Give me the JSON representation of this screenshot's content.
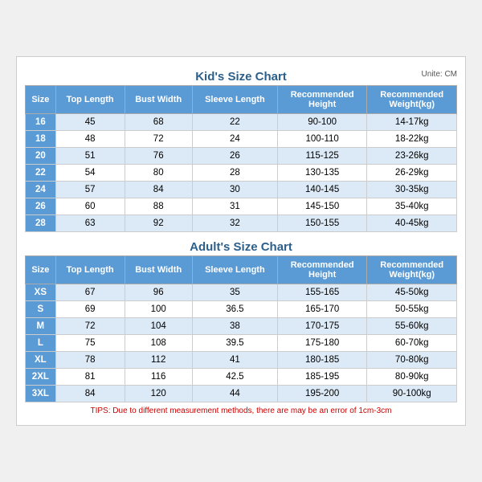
{
  "kids": {
    "title": "Kid's Size Chart",
    "unit": "Unite: CM",
    "headers": [
      "Size",
      "Top Length",
      "Bust Width",
      "Sleeve Length",
      "Recommended Height",
      "Recommended Weight(kg)"
    ],
    "rows": [
      [
        "16",
        "45",
        "68",
        "22",
        "90-100",
        "14-17kg"
      ],
      [
        "18",
        "48",
        "72",
        "24",
        "100-110",
        "18-22kg"
      ],
      [
        "20",
        "51",
        "76",
        "26",
        "115-125",
        "23-26kg"
      ],
      [
        "22",
        "54",
        "80",
        "28",
        "130-135",
        "26-29kg"
      ],
      [
        "24",
        "57",
        "84",
        "30",
        "140-145",
        "30-35kg"
      ],
      [
        "26",
        "60",
        "88",
        "31",
        "145-150",
        "35-40kg"
      ],
      [
        "28",
        "63",
        "92",
        "32",
        "150-155",
        "40-45kg"
      ]
    ]
  },
  "adults": {
    "title": "Adult's Size Chart",
    "headers": [
      "Size",
      "Top Length",
      "Bust Width",
      "Sleeve Length",
      "Recommended Height",
      "Recommended Weight(kg)"
    ],
    "rows": [
      [
        "XS",
        "67",
        "96",
        "35",
        "155-165",
        "45-50kg"
      ],
      [
        "S",
        "69",
        "100",
        "36.5",
        "165-170",
        "50-55kg"
      ],
      [
        "M",
        "72",
        "104",
        "38",
        "170-175",
        "55-60kg"
      ],
      [
        "L",
        "75",
        "108",
        "39.5",
        "175-180",
        "60-70kg"
      ],
      [
        "XL",
        "78",
        "112",
        "41",
        "180-185",
        "70-80kg"
      ],
      [
        "2XL",
        "81",
        "116",
        "42.5",
        "185-195",
        "80-90kg"
      ],
      [
        "3XL",
        "84",
        "120",
        "44",
        "195-200",
        "90-100kg"
      ]
    ]
  },
  "tips": "TIPS: Due to different measurement methods, there are may be an error of 1cm-3cm"
}
